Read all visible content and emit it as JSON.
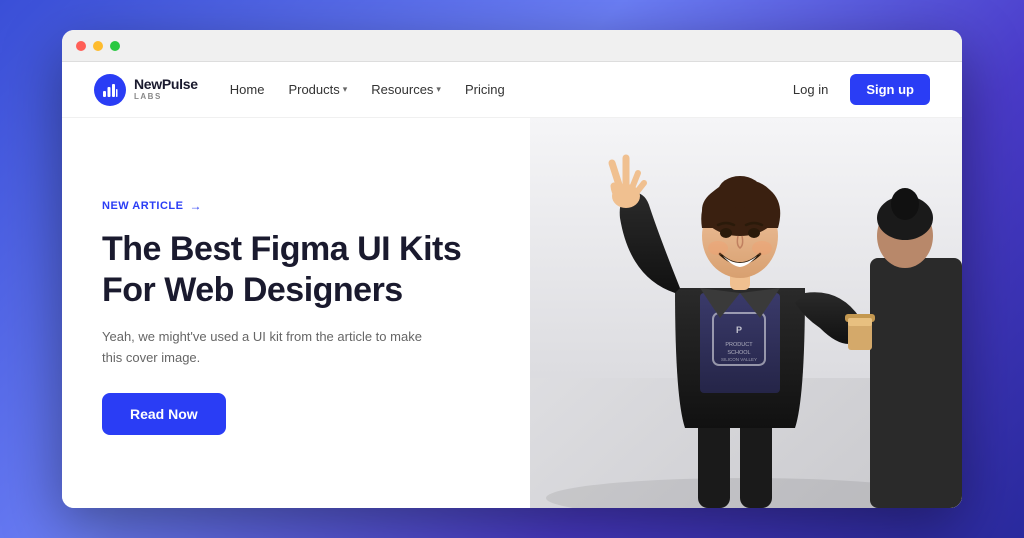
{
  "browser": {
    "dots": [
      "red",
      "yellow",
      "green"
    ]
  },
  "navbar": {
    "logo": {
      "name": "NewPulse",
      "sub": "LABS"
    },
    "nav_items": [
      {
        "label": "Home",
        "has_dropdown": false
      },
      {
        "label": "Products",
        "has_dropdown": true
      },
      {
        "label": "Resources",
        "has_dropdown": true
      },
      {
        "label": "Pricing",
        "has_dropdown": false
      }
    ],
    "actions": {
      "login": "Log in",
      "signup": "Sign up"
    }
  },
  "hero": {
    "badge": "NEW ARTICLE",
    "badge_arrow": "→",
    "title_line1": "The Best Figma UI Kits",
    "title_line2": "For Web Designers",
    "subtitle": "Yeah, we might've used a UI kit from the article to make this cover image.",
    "cta": "Read Now"
  },
  "colors": {
    "brand_blue": "#2a3df5",
    "text_dark": "#1a1a2e",
    "text_muted": "#666666"
  }
}
